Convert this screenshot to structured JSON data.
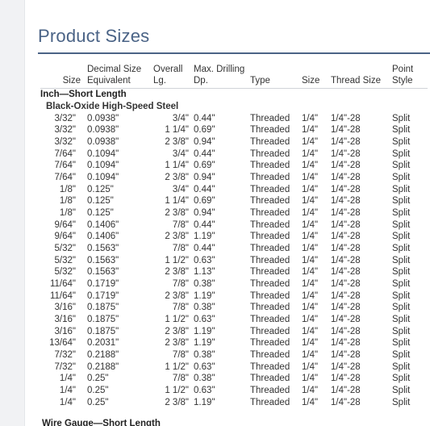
{
  "page": {
    "title": "Product Sizes"
  },
  "table": {
    "headers": {
      "size": "Size",
      "decimal": "Decimal Size Equivalent",
      "overall_length": "Overall Lg.",
      "max_drilling_depth": "Max. Drilling Dp.",
      "type": "Type",
      "shank_size": "Size",
      "thread_size": "Thread Size",
      "point_style": "Point Style"
    },
    "section_title": "Inch—Short Length",
    "subsection_title": "Black-Oxide High-Speed Steel",
    "rows": [
      [
        "3/32\"",
        "0.0938\"",
        "3/4\"",
        "0.44\"",
        "Threaded",
        "1/4\"",
        "1/4\"-28",
        "Split"
      ],
      [
        "3/32\"",
        "0.0938\"",
        "1 1/4\"",
        "0.69\"",
        "Threaded",
        "1/4\"",
        "1/4\"-28",
        "Split"
      ],
      [
        "3/32\"",
        "0.0938\"",
        "2 3/8\"",
        "0.94\"",
        "Threaded",
        "1/4\"",
        "1/4\"-28",
        "Split"
      ],
      [
        "7/64\"",
        "0.1094\"",
        "3/4\"",
        "0.44\"",
        "Threaded",
        "1/4\"",
        "1/4\"-28",
        "Split"
      ],
      [
        "7/64\"",
        "0.1094\"",
        "1 1/4\"",
        "0.69\"",
        "Threaded",
        "1/4\"",
        "1/4\"-28",
        "Split"
      ],
      [
        "7/64\"",
        "0.1094\"",
        "2 3/8\"",
        "0.94\"",
        "Threaded",
        "1/4\"",
        "1/4\"-28",
        "Split"
      ],
      [
        "1/8\"",
        "0.125\"",
        "3/4\"",
        "0.44\"",
        "Threaded",
        "1/4\"",
        "1/4\"-28",
        "Split"
      ],
      [
        "1/8\"",
        "0.125\"",
        "1 1/4\"",
        "0.69\"",
        "Threaded",
        "1/4\"",
        "1/4\"-28",
        "Split"
      ],
      [
        "1/8\"",
        "0.125\"",
        "2 3/8\"",
        "0.94\"",
        "Threaded",
        "1/4\"",
        "1/4\"-28",
        "Split"
      ],
      [
        "9/64\"",
        "0.1406\"",
        "7/8\"",
        "0.44\"",
        "Threaded",
        "1/4\"",
        "1/4\"-28",
        "Split"
      ],
      [
        "9/64\"",
        "0.1406\"",
        "2 3/8\"",
        "1.19\"",
        "Threaded",
        "1/4\"",
        "1/4\"-28",
        "Split"
      ],
      [
        "5/32\"",
        "0.1563\"",
        "7/8\"",
        "0.44\"",
        "Threaded",
        "1/4\"",
        "1/4\"-28",
        "Split"
      ],
      [
        "5/32\"",
        "0.1563\"",
        "1 1/2\"",
        "0.63\"",
        "Threaded",
        "1/4\"",
        "1/4\"-28",
        "Split"
      ],
      [
        "5/32\"",
        "0.1563\"",
        "2 3/8\"",
        "1.13\"",
        "Threaded",
        "1/4\"",
        "1/4\"-28",
        "Split"
      ],
      [
        "11/64\"",
        "0.1719\"",
        "7/8\"",
        "0.38\"",
        "Threaded",
        "1/4\"",
        "1/4\"-28",
        "Split"
      ],
      [
        "11/64\"",
        "0.1719\"",
        "2 3/8\"",
        "1.19\"",
        "Threaded",
        "1/4\"",
        "1/4\"-28",
        "Split"
      ],
      [
        "3/16\"",
        "0.1875\"",
        "7/8\"",
        "0.38\"",
        "Threaded",
        "1/4\"",
        "1/4\"-28",
        "Split"
      ],
      [
        "3/16\"",
        "0.1875\"",
        "1 1/2\"",
        "0.63\"",
        "Threaded",
        "1/4\"",
        "1/4\"-28",
        "Split"
      ],
      [
        "3/16\"",
        "0.1875\"",
        "2 3/8\"",
        "1.19\"",
        "Threaded",
        "1/4\"",
        "1/4\"-28",
        "Split"
      ],
      [
        "13/64\"",
        "0.2031\"",
        "2 3/8\"",
        "1.19\"",
        "Threaded",
        "1/4\"",
        "1/4\"-28",
        "Split"
      ],
      [
        "7/32\"",
        "0.2188\"",
        "7/8\"",
        "0.38\"",
        "Threaded",
        "1/4\"",
        "1/4\"-28",
        "Split"
      ],
      [
        "7/32\"",
        "0.2188\"",
        "1 1/2\"",
        "0.63\"",
        "Threaded",
        "1/4\"",
        "1/4\"-28",
        "Split"
      ],
      [
        "1/4\"",
        "0.25\"",
        "7/8\"",
        "0.38\"",
        "Threaded",
        "1/4\"",
        "1/4\"-28",
        "Split"
      ],
      [
        "1/4\"",
        "0.25\"",
        "1 1/2\"",
        "0.63\"",
        "Threaded",
        "1/4\"",
        "1/4\"-28",
        "Split"
      ],
      [
        "1/4\"",
        "0.25\"",
        "2 3/8\"",
        "1.19\"",
        "Threaded",
        "1/4\"",
        "1/4\"-28",
        "Split"
      ]
    ],
    "next_section_title": "Wire Gauge—Short Length"
  }
}
